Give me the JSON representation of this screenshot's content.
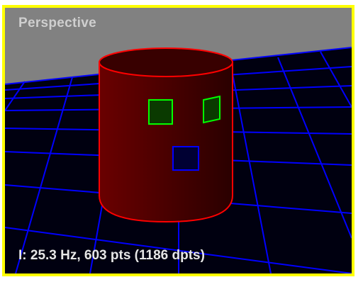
{
  "viewport": {
    "label": "Perspective",
    "status": "I: 25.3 Hz, 603 pts (1186 dpts)"
  },
  "colors": {
    "frame_border": "#ffff00",
    "background": "#818181",
    "ground": "#000010",
    "grid": "#0000ff",
    "cylinder_fill": "#4a0000",
    "cylinder_edge": "#ff0000",
    "eye_marker": "#00ff00",
    "mouth_marker": "#0000ff"
  },
  "scene": {
    "object": "cylinder",
    "markers": [
      "left-eye-square",
      "right-eye-square",
      "mouth-square"
    ]
  }
}
